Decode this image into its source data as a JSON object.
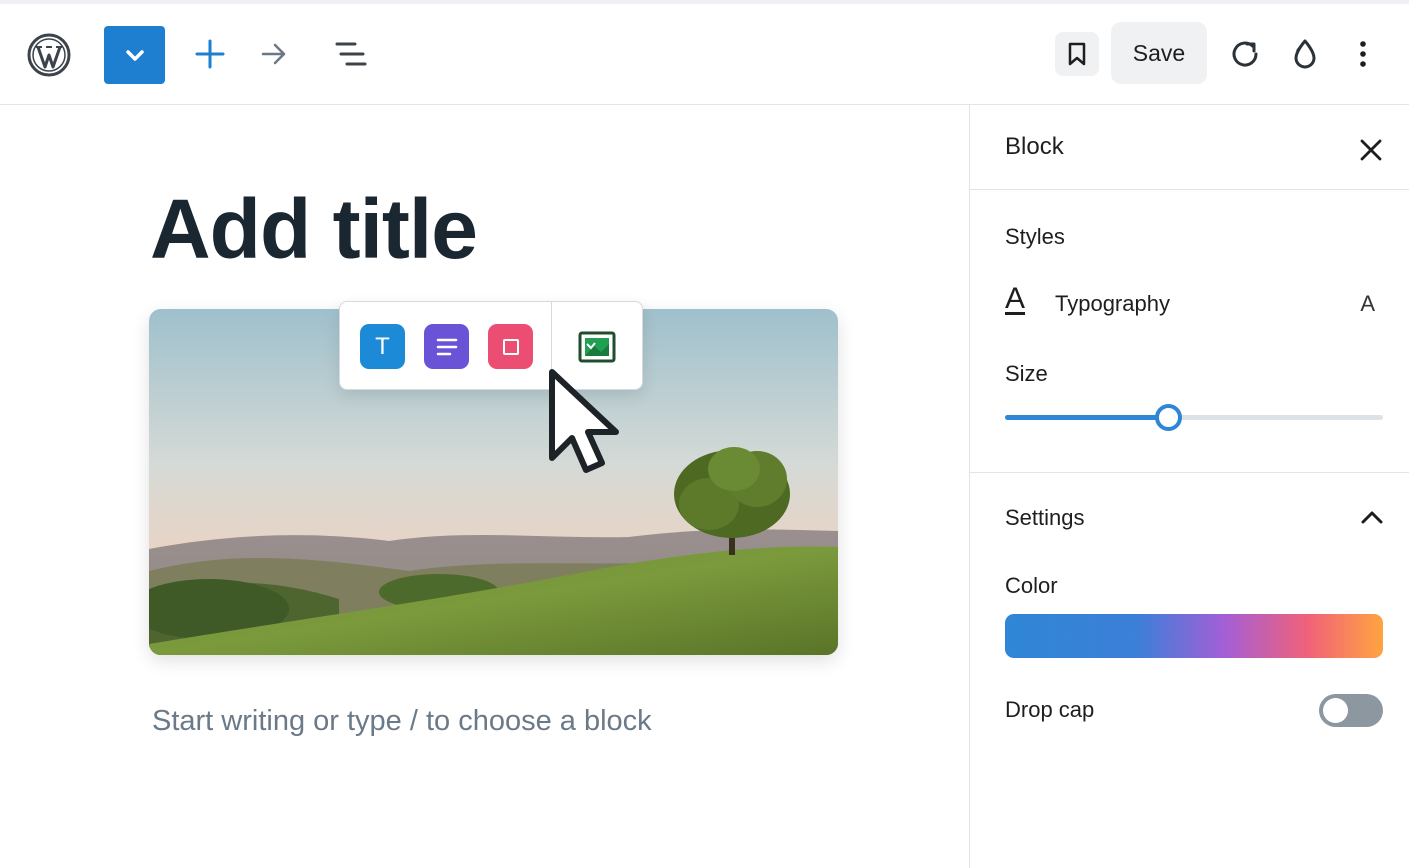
{
  "header": {
    "logo_icon": "wordpress-logo",
    "block_toggle_icon": "chevron-down-icon",
    "add_icon": "plus-icon",
    "redo_icon": "arrow-right-icon",
    "list_view_icon": "list-view-icon",
    "bookmark_icon": "bookmark-icon",
    "save_label": "Save",
    "refresh_icon": "refresh-icon",
    "drop_icon": "drop-icon",
    "more_icon": "more-vertical-icon",
    "accent_color": "#1e7fd1"
  },
  "editor": {
    "title_placeholder": "Add title",
    "paragraph_placeholder": "Start writing or type / to choose a block",
    "image_description": "landscape-hills-tree"
  },
  "block_toolbar": {
    "items": [
      {
        "icon": "text-icon",
        "glyph": "T",
        "color": "#1c8ad6"
      },
      {
        "icon": "paragraph-icon",
        "color": "#6b53d8"
      },
      {
        "icon": "group-icon",
        "color": "#ec4d72"
      },
      {
        "icon": "image-icon",
        "color": "#1f6b3c"
      }
    ]
  },
  "sidebar": {
    "title": "Block",
    "styles_label": "Styles",
    "typography_glyph": "A",
    "typography_label": "Typography",
    "typography_indicator": "A",
    "size_label": "Size",
    "size_value_fraction": 0.43,
    "settings_label": "Settings",
    "color_label": "Color",
    "color_gradient": [
      "#2f86d6",
      "#a35fd6",
      "#f0617a",
      "#ffa440"
    ],
    "dropcap_label": "Drop cap",
    "dropcap_enabled": false
  }
}
